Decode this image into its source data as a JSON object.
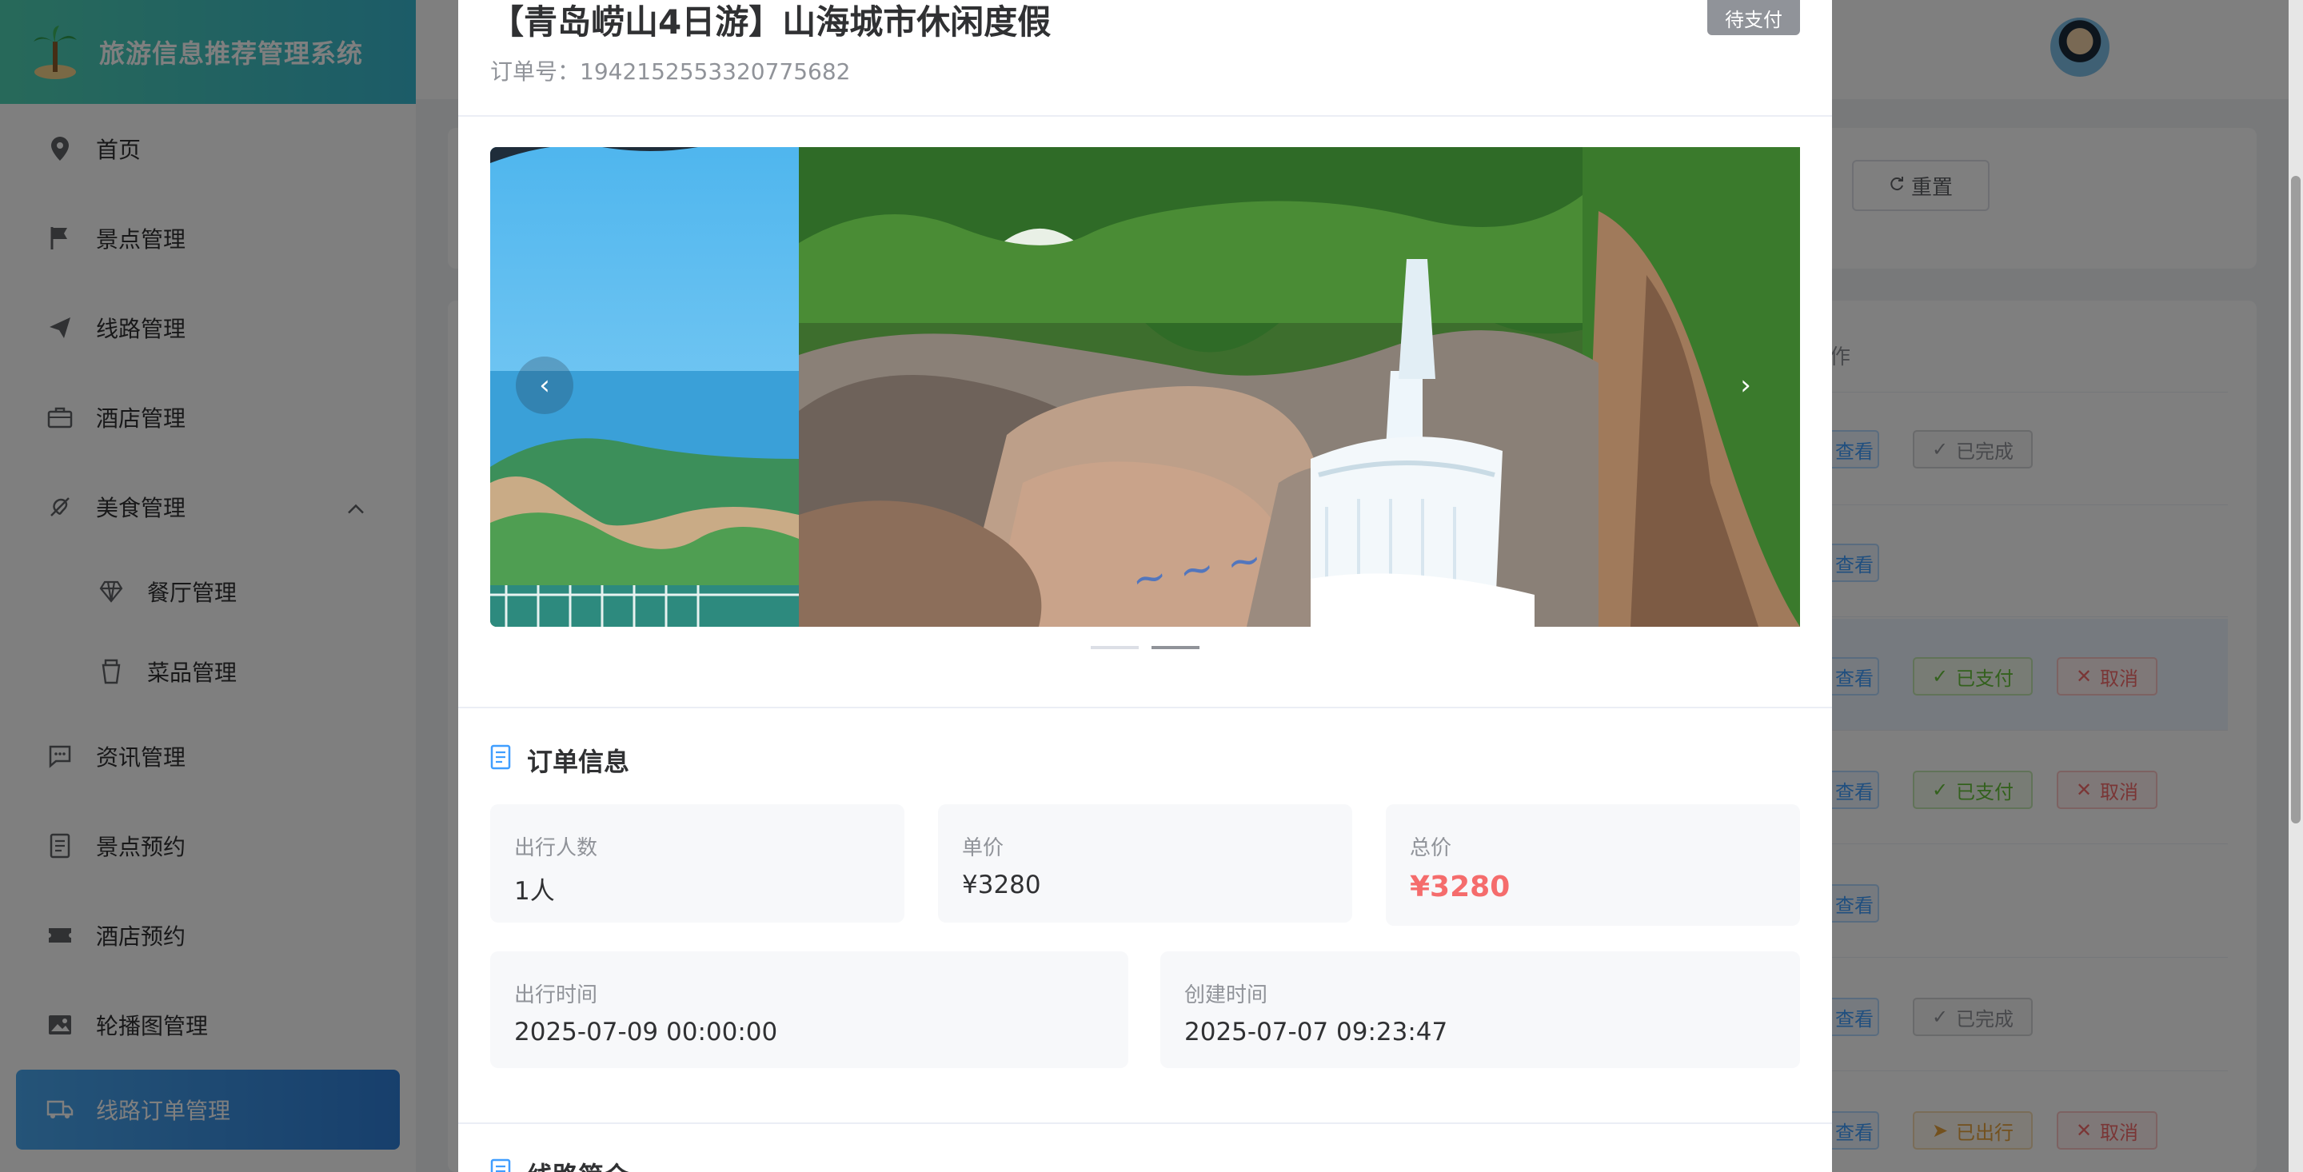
{
  "app": {
    "title": "旅游信息推荐管理系统"
  },
  "sidebar": {
    "items": [
      {
        "label": "首页",
        "icon": "location-icon"
      },
      {
        "label": "景点管理",
        "icon": "flag-icon"
      },
      {
        "label": "线路管理",
        "icon": "send-icon"
      },
      {
        "label": "酒店管理",
        "icon": "suitcase-icon"
      },
      {
        "label": "美食管理",
        "icon": "food-icon"
      },
      {
        "label": "餐厅管理",
        "icon": "diamond-icon"
      },
      {
        "label": "菜品管理",
        "icon": "cup-icon"
      },
      {
        "label": "资讯管理",
        "icon": "chat-icon"
      },
      {
        "label": "景点预约",
        "icon": "document-icon"
      },
      {
        "label": "酒店预约",
        "icon": "ticket-icon"
      },
      {
        "label": "轮播图管理",
        "icon": "picture-icon"
      },
      {
        "label": "线路订单管理",
        "icon": "truck-icon"
      }
    ]
  },
  "toolbar": {
    "reset_label": "重置"
  },
  "table": {
    "header_fragment": "作",
    "view_label": "查看",
    "rows": [
      {
        "status": "已完成",
        "type": "done"
      },
      {
        "status": "",
        "type": "none"
      },
      {
        "status": "已支付",
        "type": "paid",
        "cancel": "取消"
      },
      {
        "status": "已支付",
        "type": "paid",
        "cancel": "取消"
      },
      {
        "status": "",
        "type": "none"
      },
      {
        "status": "已完成",
        "type": "done"
      },
      {
        "status": "已出行",
        "type": "out",
        "cancel": "取消"
      }
    ]
  },
  "dialog": {
    "title": "【青岛崂山4日游】山海城市休闲度假",
    "order_no_label": "订单号：",
    "order_no": "1942152553320775682",
    "status": "待支付",
    "carousel": {
      "slides": 2,
      "active_index": 1
    },
    "order_info": {
      "title": "订单信息",
      "people_label": "出行人数",
      "people_value": "1人",
      "unit_price_label": "单价",
      "unit_price_value": "¥3280",
      "total_label": "总价",
      "total_value": "¥3280",
      "travel_time_label": "出行时间",
      "travel_time_value": "2025-07-09 00:00:00",
      "created_label": "创建时间",
      "created_value": "2025-07-07 09:23:47"
    },
    "route_intro": {
      "title": "线路简介"
    }
  },
  "colors": {
    "accent": "#409eff",
    "price": "#f56c6c",
    "logo_gradient_start": "#4fd3b4",
    "logo_gradient_end": "#39b8d0",
    "active_menu": "#2f7fd9"
  }
}
